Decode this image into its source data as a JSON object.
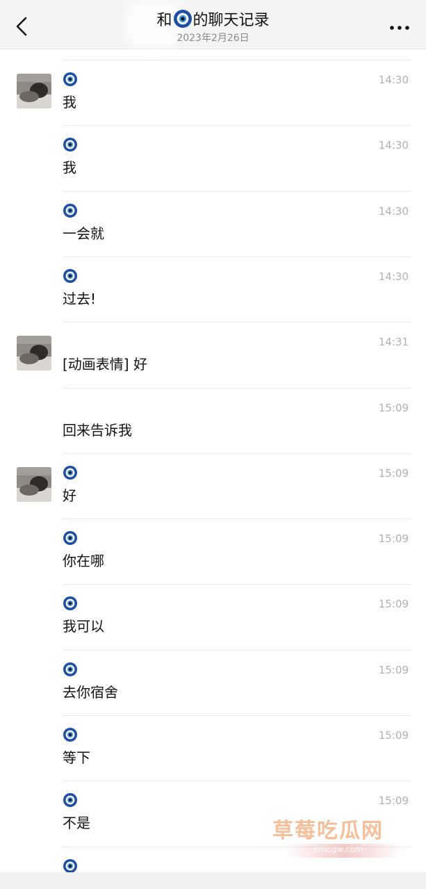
{
  "header": {
    "title_prefix": "和",
    "title_suffix": "的聊天记录",
    "date": "2023年2月26日",
    "back_icon": "chevron-left-icon",
    "more_icon": "more-dots-icon",
    "bar_color": "#f4f4f4"
  },
  "messages": [
    {
      "sender_icon": "evil-eye-icon",
      "time": "14:30",
      "text": "我",
      "avatar": true
    },
    {
      "sender_icon": "evil-eye-icon",
      "time": "14:30",
      "text": "我",
      "avatar": false
    },
    {
      "sender_icon": "evil-eye-icon",
      "time": "14:30",
      "text": "一会就",
      "avatar": false
    },
    {
      "sender_icon": "evil-eye-icon",
      "time": "14:30",
      "text": "过去!",
      "avatar": false
    },
    {
      "sender_icon": "",
      "time": "14:31",
      "text": "[动画表情] 好",
      "avatar": true
    },
    {
      "sender_icon": "",
      "time": "15:09",
      "text": "回来告诉我",
      "avatar": false
    },
    {
      "sender_icon": "evil-eye-icon",
      "time": "15:09",
      "text": "好",
      "avatar": true
    },
    {
      "sender_icon": "evil-eye-icon",
      "time": "15:09",
      "text": "你在哪",
      "avatar": false
    },
    {
      "sender_icon": "evil-eye-icon",
      "time": "15:09",
      "text": "我可以",
      "avatar": false
    },
    {
      "sender_icon": "evil-eye-icon",
      "time": "15:09",
      "text": "去你宿舍",
      "avatar": false
    },
    {
      "sender_icon": "evil-eye-icon",
      "time": "15:09",
      "text": "等下",
      "avatar": false
    },
    {
      "sender_icon": "evil-eye-icon",
      "time": "15:09",
      "text": "不是",
      "avatar": false
    },
    {
      "sender_icon": "evil-eye-icon",
      "time": "",
      "text": "",
      "avatar": false
    }
  ],
  "watermark": {
    "main": "草莓吃瓜网",
    "url": "cmcgw.com"
  }
}
